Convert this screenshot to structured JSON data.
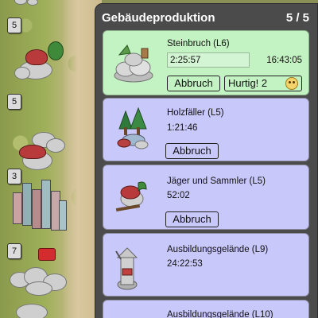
{
  "map": {
    "level_badges": [
      "5",
      "5",
      "3",
      "7"
    ]
  },
  "panel": {
    "title": "Gebäudeproduktion",
    "count": "5 / 5",
    "items": [
      {
        "name": "Steinbruch (L6)",
        "timer": "2:25:57",
        "finish_time": "16:43:05",
        "cancel_label": "Abbruch",
        "hurry_label": "Hurtig! 2",
        "hurry_icon": "smiley-coin-icon",
        "state": "active"
      },
      {
        "name": "Holzfäller (L5)",
        "timer": "1:21:46",
        "cancel_label": "Abbruch",
        "state": "queued"
      },
      {
        "name": "Jäger und Sammler (L5)",
        "timer": "52:02",
        "cancel_label": "Abbruch",
        "state": "queued"
      },
      {
        "name": "Ausbildungsgelände (L9)",
        "timer": "24:22:53",
        "state": "queued"
      },
      {
        "name": "Ausbildungsgelände (L10)",
        "state": "queued"
      }
    ]
  },
  "colors": {
    "panel_bg": "#4b4b4b",
    "active_card": "#c3f2c3",
    "queued_card": "#c9c8fb"
  }
}
